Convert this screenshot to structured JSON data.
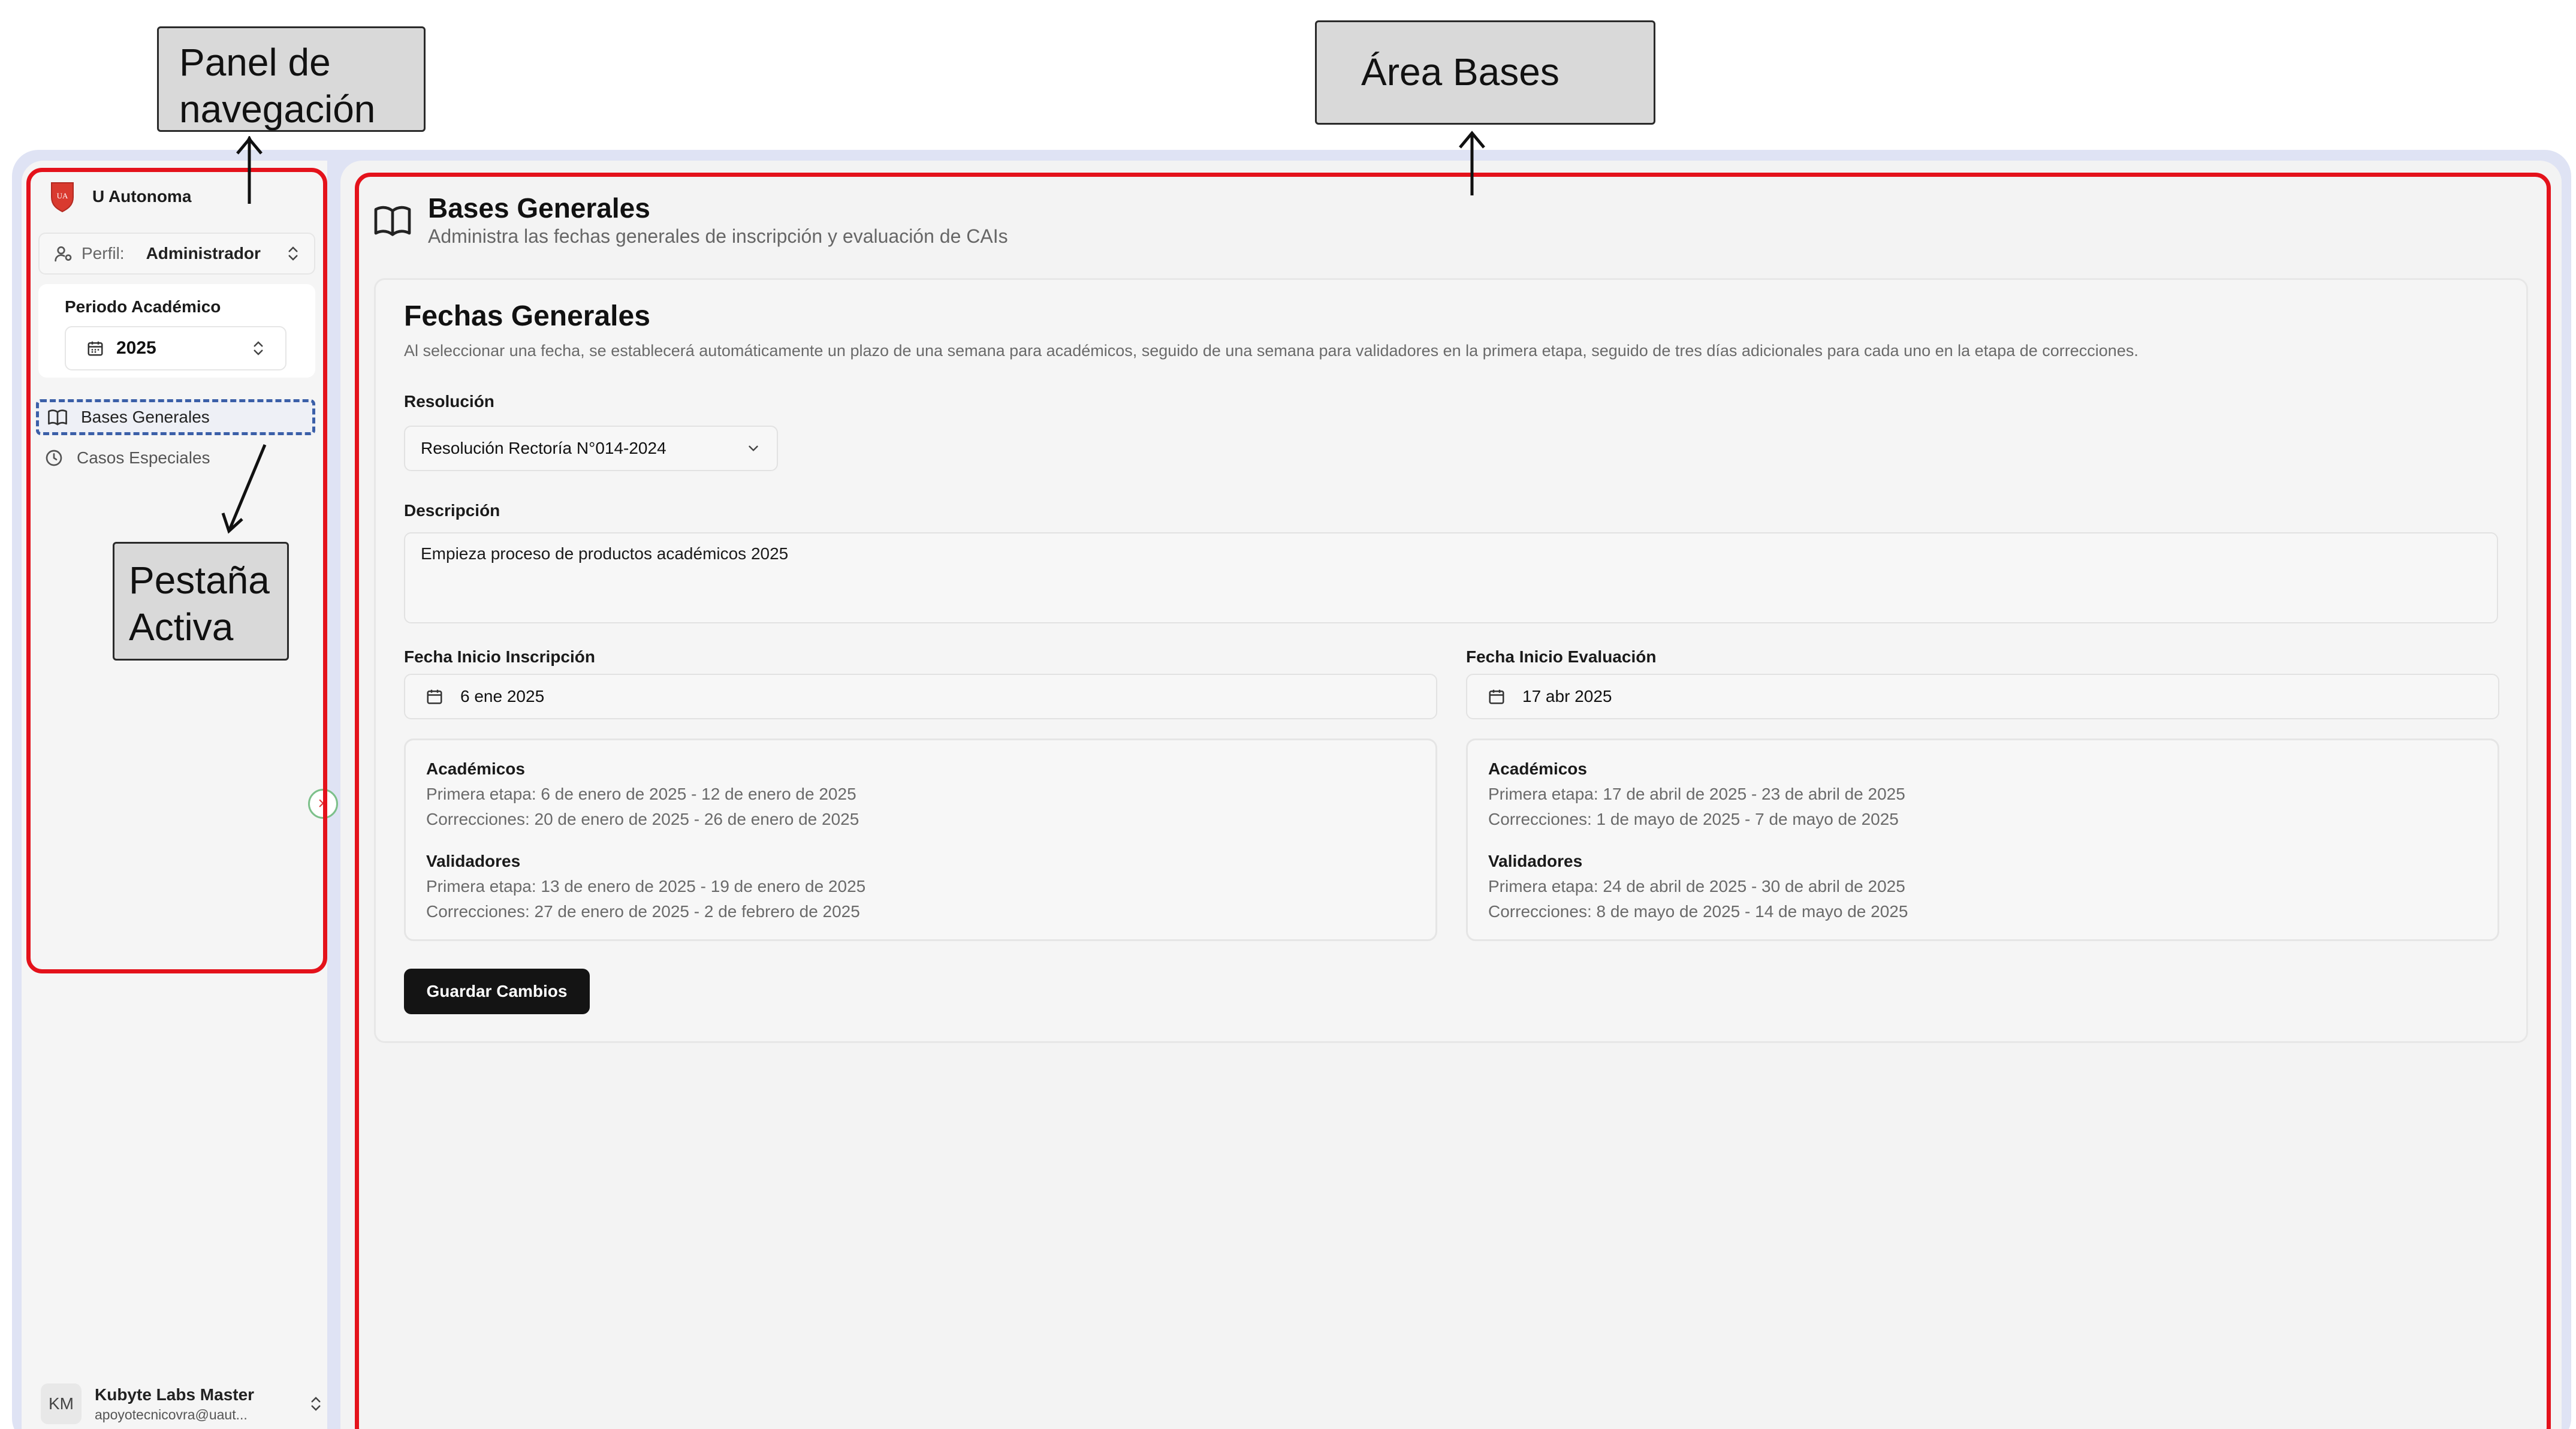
{
  "annotations": {
    "navigation_panel": "Panel de navegación",
    "bases_area": "Área Bases",
    "active_tab": "Pestaña Activa"
  },
  "sidebar": {
    "org_name": "U Autonoma",
    "logo_text": "UA",
    "profile_label": "Perfil:",
    "profile_value": "Administrador",
    "period_label": "Periodo Académico",
    "period_value": "2025",
    "nav_items": [
      {
        "label": "Bases Generales",
        "icon": "book-open-icon",
        "active": true
      },
      {
        "label": "Casos Especiales",
        "icon": "clock-icon",
        "active": false
      }
    ],
    "user": {
      "initials": "KM",
      "name": "Kubyte Labs Master",
      "email": "apoyotecnicovra@uaut..."
    }
  },
  "page": {
    "title": "Bases Generales",
    "subtitle": "Administra las fechas generales de inscripción y evaluación de CAIs"
  },
  "card": {
    "title": "Fechas Generales",
    "description": "Al seleccionar una fecha, se establecerá automáticamente un plazo de una semana para académicos, seguido de una semana para validadores en la primera etapa, seguido de tres días adicionales para cada uno en la etapa de correcciones.",
    "resolution_label": "Resolución",
    "resolution_value": "Resolución Rectoría N°014-2024",
    "description_label": "Descripción",
    "description_value": "Empieza proceso de productos académicos 2025",
    "start_inscription_label": "Fecha Inicio Inscripción",
    "start_inscription_value": "6 ene 2025",
    "start_evaluation_label": "Fecha Inicio Evaluación",
    "start_evaluation_value": "17 abr 2025",
    "inscription_schedule": {
      "academics_heading": "Académicos",
      "academics_first": "Primera etapa: 6 de enero de 2025 - 12 de enero de 2025",
      "academics_corrections": "Correcciones: 20 de enero de 2025 - 26 de enero de 2025",
      "validators_heading": "Validadores",
      "validators_first": "Primera etapa: 13 de enero de 2025 - 19 de enero de 2025",
      "validators_corrections": "Correcciones: 27 de enero de 2025 - 2 de febrero de 2025"
    },
    "evaluation_schedule": {
      "academics_heading": "Académicos",
      "academics_first": "Primera etapa: 17 de abril de 2025 - 23 de abril de 2025",
      "academics_corrections": "Correcciones: 1 de mayo de 2025 - 7 de mayo de 2025",
      "validators_heading": "Validadores",
      "validators_first": "Primera etapa: 24 de abril de 2025 - 30 de abril de 2025",
      "validators_corrections": "Correcciones: 8 de mayo de 2025 - 14 de mayo de 2025"
    },
    "save_button": "Guardar Cambios"
  },
  "colors": {
    "highlight_red": "#e4121b",
    "active_tab_dash": "#3b5fa8",
    "primary_button": "#141414",
    "frame_background": "#dfe3f4"
  }
}
